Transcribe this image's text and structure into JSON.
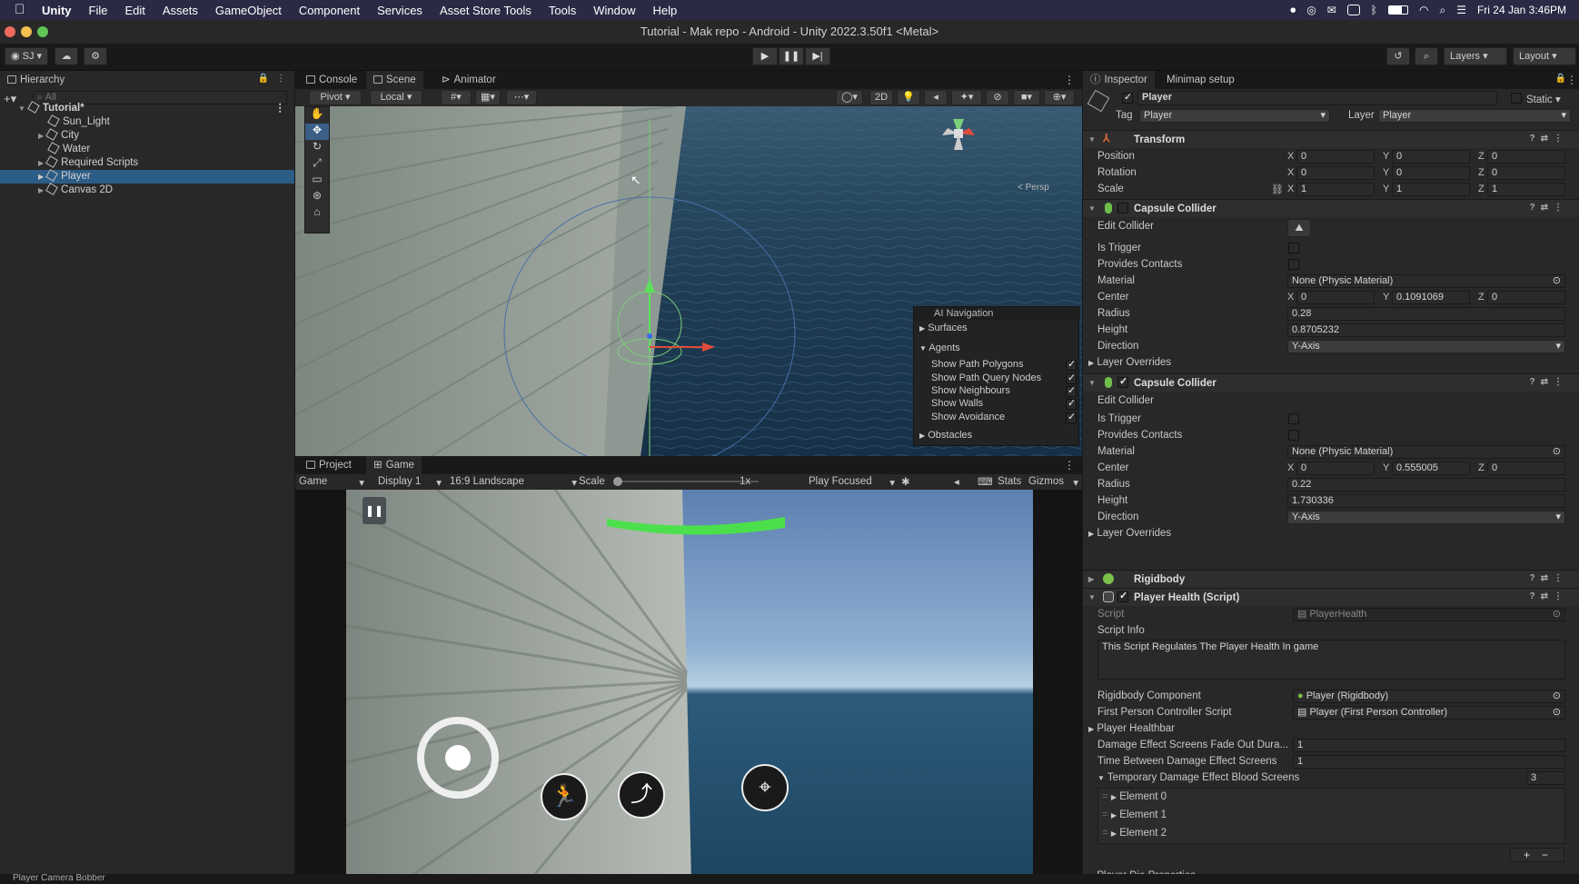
{
  "menubar": {
    "app": "Unity",
    "items": [
      "File",
      "Edit",
      "Assets",
      "GameObject",
      "Component",
      "Services",
      "Asset Store Tools",
      "Tools",
      "Window",
      "Help"
    ],
    "clock": "Fri 24 Jan  3:46PM"
  },
  "window": {
    "title": "Tutorial - Mak repo - Android - Unity 2022.3.50f1 <Metal>"
  },
  "toolbar": {
    "account": "SJ",
    "layers": "Layers",
    "layout": "Layout"
  },
  "hierarchy": {
    "tab": "Hierarchy",
    "search_placeholder": "All",
    "scene": "Tutorial*",
    "items": [
      "Sun_Light",
      "City",
      "Water",
      "Required Scripts",
      "Player",
      "Canvas 2D"
    ]
  },
  "scene_panel": {
    "tabs": [
      "Console",
      "Scene",
      "Animator"
    ],
    "pivot": "Pivot",
    "local": "Local",
    "two_d": "2D",
    "persp": "< Persp"
  },
  "nav_overlay": {
    "title": "AI Navigation",
    "surfaces": "Surfaces",
    "agents": "Agents",
    "options": [
      "Show Path Polygons",
      "Show Path Query Nodes",
      "Show Neighbours",
      "Show Walls",
      "Show Avoidance"
    ],
    "obstacles": "Obstacles"
  },
  "game_panel": {
    "tabs": [
      "Project",
      "Game"
    ],
    "mode": "Game",
    "display": "Display 1",
    "aspect": "16:9 Landscape",
    "scale_label": "Scale",
    "scale_value": "1x",
    "play_focused": "Play Focused",
    "stats": "Stats",
    "gizmos": "Gizmos"
  },
  "inspector": {
    "tabs": [
      "Inspector",
      "Minimap setup"
    ],
    "object_name": "Player",
    "static_label": "Static",
    "tag_label": "Tag",
    "tag_value": "Player",
    "layer_label": "Layer",
    "layer_value": "Player",
    "transform": {
      "title": "Transform",
      "position_label": "Position",
      "position": [
        "0",
        "0",
        "0"
      ],
      "rotation_label": "Rotation",
      "rotation": [
        "0",
        "0",
        "0"
      ],
      "scale_label": "Scale",
      "scale": [
        "1",
        "1",
        "1"
      ]
    },
    "capsule1": {
      "title": "Capsule Collider",
      "edit_collider": "Edit Collider",
      "is_trigger": "Is Trigger",
      "provides_contacts": "Provides Contacts",
      "material_label": "Material",
      "material": "None (Physic Material)",
      "center_label": "Center",
      "center": [
        "0",
        "0.1091069",
        "0"
      ],
      "radius_label": "Radius",
      "radius": "0.28",
      "height_label": "Height",
      "height": "0.8705232",
      "direction_label": "Direction",
      "direction": "Y-Axis",
      "layer_overrides": "Layer Overrides"
    },
    "capsule2": {
      "title": "Capsule Collider",
      "edit_collider": "Edit Collider",
      "is_trigger": "Is Trigger",
      "provides_contacts": "Provides Contacts",
      "material_label": "Material",
      "material": "None (Physic Material)",
      "center_label": "Center",
      "center": [
        "0",
        "0.555005",
        "0"
      ],
      "radius_label": "Radius",
      "radius": "0.22",
      "height_label": "Height",
      "height": "1.730336",
      "direction_label": "Direction",
      "direction": "Y-Axis",
      "layer_overrides": "Layer Overrides"
    },
    "rigidbody": {
      "title": "Rigidbody"
    },
    "health": {
      "title": "Player Health (Script)",
      "script_label": "Script",
      "script": "PlayerHealth",
      "info_label": "Script Info",
      "info_text": "This Script Regulates The Player Health In game",
      "rb_label": "Rigidbody Component",
      "rb_value": "Player (Rigidbody)",
      "fpc_label": "First Person Controller Script",
      "fpc_value": "Player (First Person Controller)",
      "healthbar": "Player Healthbar",
      "fade_label": "Damage Effect Screens Fade Out Dura...",
      "fade_value": "1",
      "between_label": "Time Between Damage Effect Screens",
      "between_value": "1",
      "blood_label": "Temporary Damage Effect Blood Screens",
      "blood_count": "3",
      "elements": [
        "Element 0",
        "Element 1",
        "Element 2"
      ],
      "die": "Player Die Properties"
    }
  },
  "statusbar": {
    "text": "Player Camera Bobber"
  },
  "colors": {
    "menubar": "#2b2a45",
    "selection": "#2c5d87",
    "health": "#4be04b"
  }
}
